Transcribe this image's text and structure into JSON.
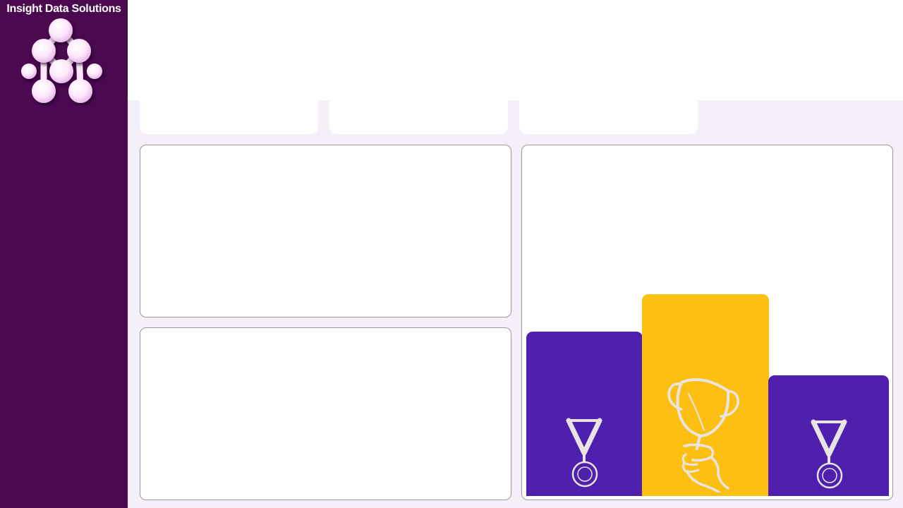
{
  "sidebar": {
    "brand_name": "Insight Data Solutions",
    "logo_icon": "molecule-dots-logo-icon"
  },
  "colors": {
    "sidebar_bg": "#4b0950",
    "page_bg": "#f5eff9",
    "podium_purple": "#4f1fae",
    "podium_gold": "#fdbf12",
    "icon_stroke": "#e9e4e4"
  },
  "podium": {
    "places": [
      {
        "rank": "second",
        "icon": "medal-icon"
      },
      {
        "rank": "first",
        "icon": "trophy-icon"
      },
      {
        "rank": "third",
        "icon": "medal-icon"
      }
    ]
  }
}
